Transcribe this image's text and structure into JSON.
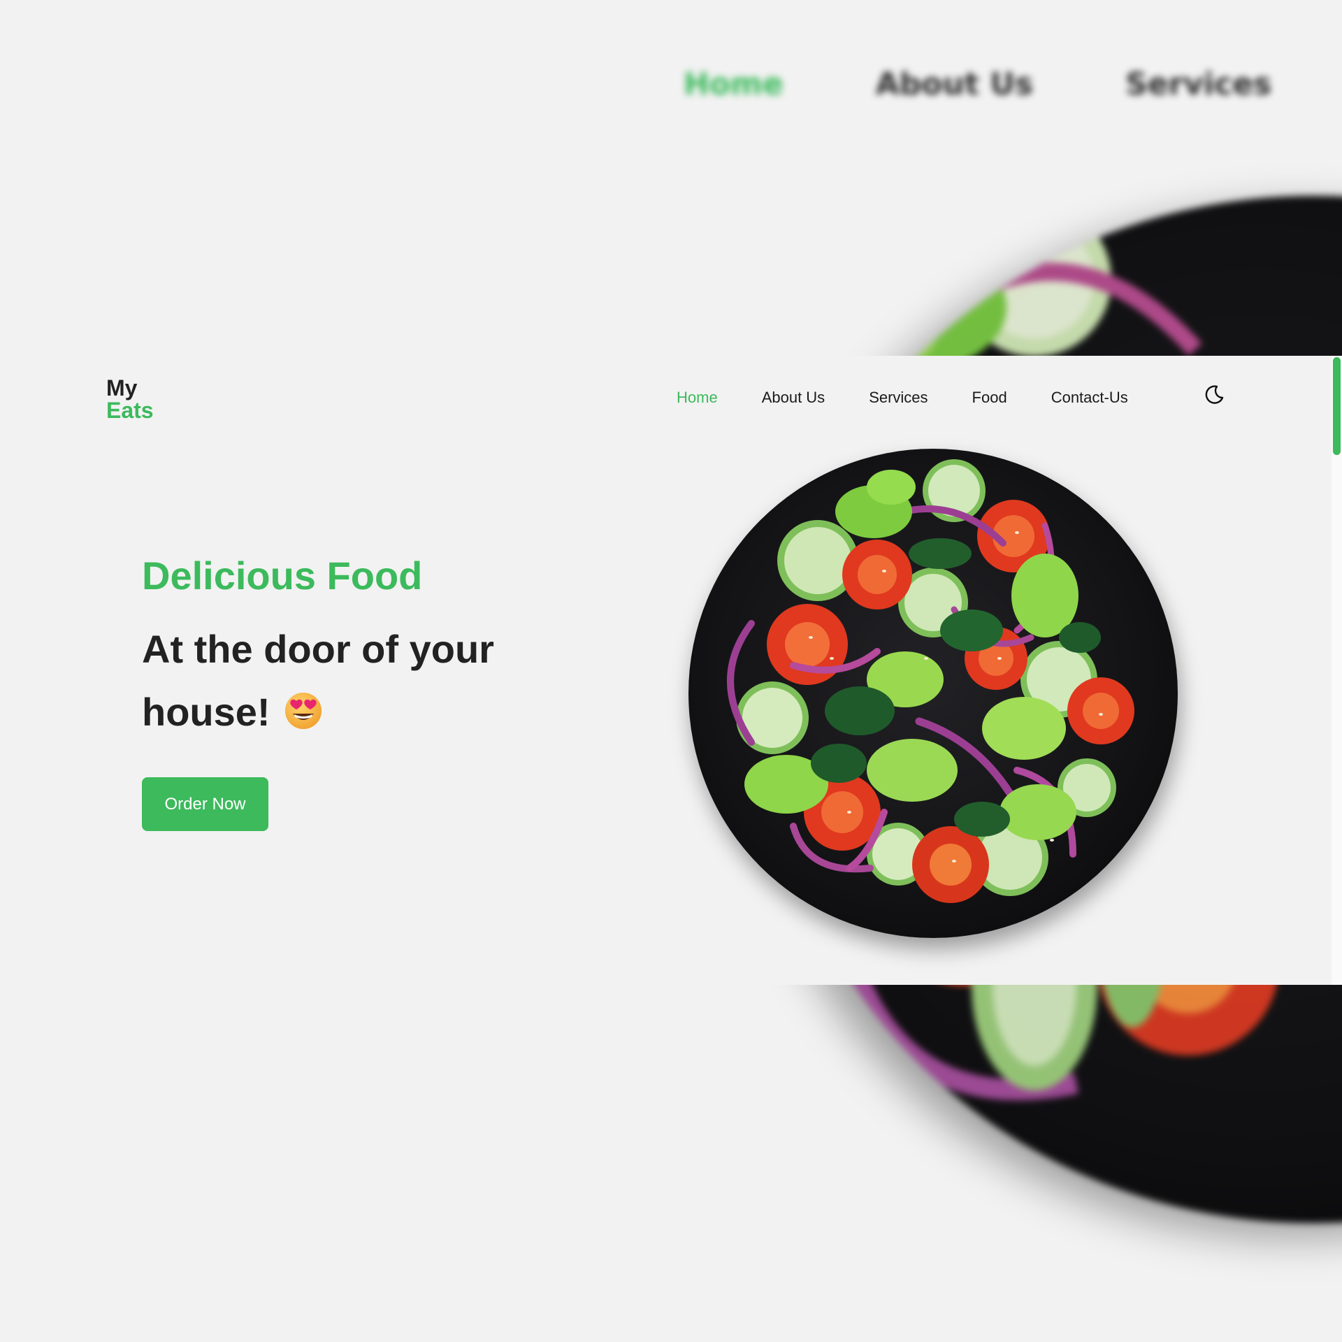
{
  "brand": {
    "line1": "My",
    "line2": "Eats"
  },
  "nav": {
    "items": [
      "Home",
      "About Us",
      "Services",
      "Food",
      "Contact-Us"
    ],
    "active": "Home",
    "theme_toggle_icon": "moon-icon"
  },
  "background_nav": {
    "items": [
      "Home",
      "About Us",
      "Services"
    ]
  },
  "hero": {
    "subtitle": "Delicious Food",
    "title": "At the door of your house!",
    "emoji_icon": "star-struck-emoji-icon",
    "cta_label": "Order Now"
  },
  "hero_image": {
    "icon": "salad-bowl-image"
  },
  "colors": {
    "accent": "#3cba5c",
    "background": "#f2f2f2",
    "text": "#222222"
  }
}
